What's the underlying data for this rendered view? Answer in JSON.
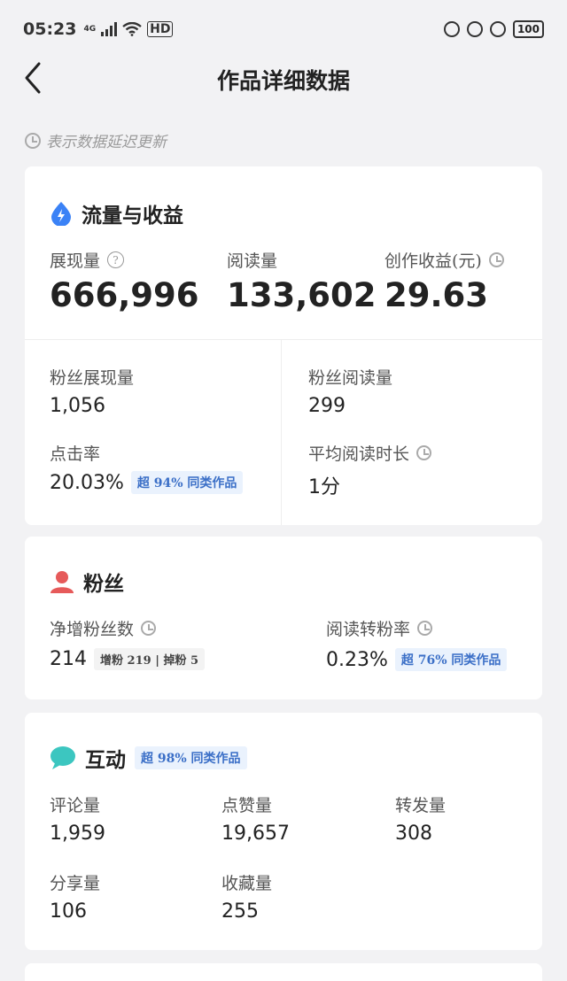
{
  "status_bar": {
    "time": "05:23",
    "network": "4G",
    "hd": "HD",
    "battery": "100"
  },
  "nav": {
    "title": "作品详细数据"
  },
  "delay_note": "表示数据延迟更新",
  "traffic": {
    "title": "流量与收益",
    "impressions_label": "展现量",
    "impressions_value": "666,996",
    "reads_label": "阅读量",
    "reads_value": "133,602",
    "revenue_label": "创作收益(元)",
    "revenue_value": "29.63",
    "fan_impressions_label": "粉丝展现量",
    "fan_impressions_value": "1,056",
    "fan_reads_label": "粉丝阅读量",
    "fan_reads_value": "299",
    "ctr_label": "点击率",
    "ctr_value": "20.03%",
    "ctr_badge": "超 94% 同类作品",
    "avg_read_label": "平均阅读时长",
    "avg_read_value": "1分"
  },
  "fans": {
    "title": "粉丝",
    "net_label": "净增粉丝数",
    "net_value": "214",
    "net_detail": "增粉 219 | 掉粉 5",
    "conv_label": "阅读转粉率",
    "conv_value": "0.23%",
    "conv_badge": "超 76% 同类作品"
  },
  "interaction": {
    "title": "互动",
    "badge": "超 98% 同类作品",
    "comments_label": "评论量",
    "comments_value": "1,959",
    "likes_label": "点赞量",
    "likes_value": "19,657",
    "reposts_label": "转发量",
    "reposts_value": "308",
    "shares_label": "分享量",
    "shares_value": "106",
    "favorites_label": "收藏量",
    "favorites_value": "255"
  },
  "colors": {
    "accent_blue": "#3b82f6",
    "fans_red": "#e65a5a",
    "chat_teal": "#3cc6c0",
    "badge_text": "#3b6fc7"
  }
}
